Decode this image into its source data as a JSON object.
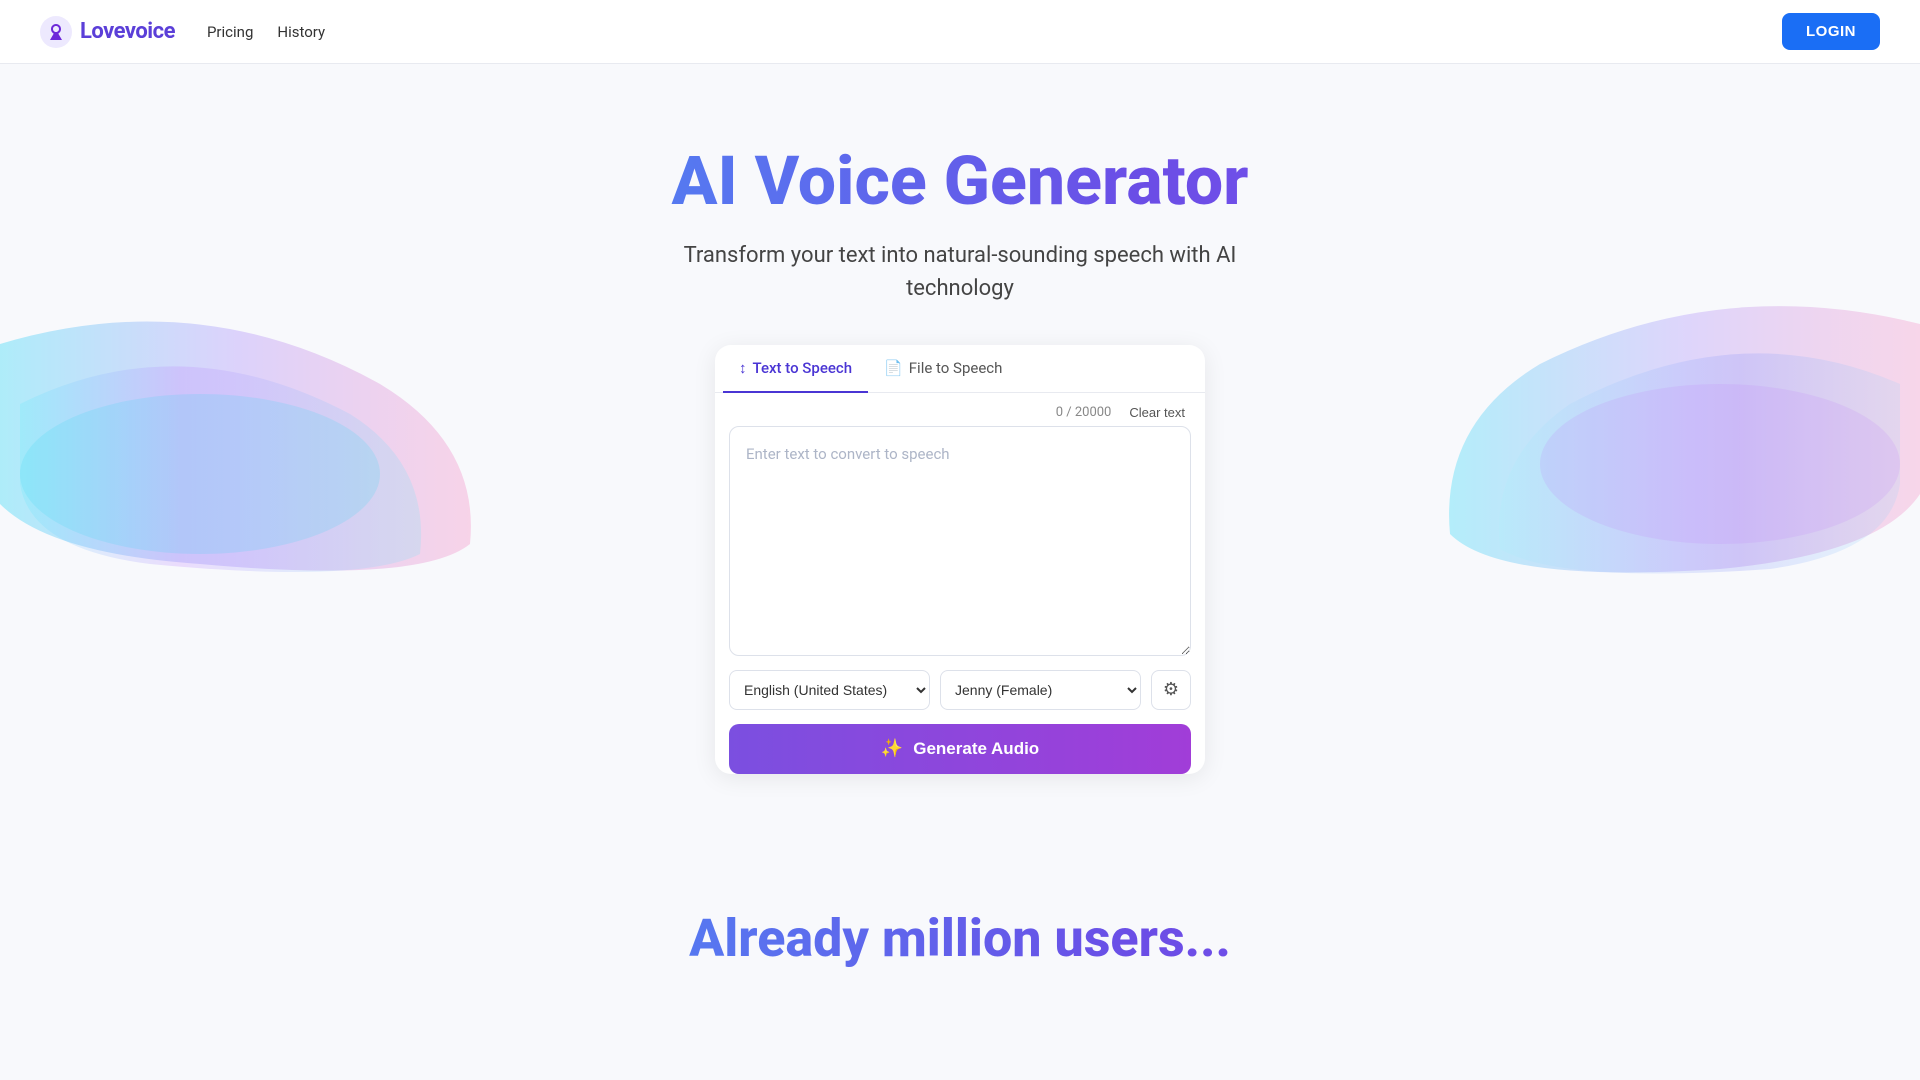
{
  "brand": {
    "name": "Lovevoice",
    "logo_alt": "Lovevoice logo"
  },
  "nav": {
    "pricing_label": "Pricing",
    "history_label": "History",
    "login_label": "LOGIN"
  },
  "hero": {
    "title": "AI Voice Generator",
    "subtitle": "Transform your text into natural-sounding speech with AI technology"
  },
  "tabs": [
    {
      "id": "text-to-speech",
      "label": "Text to Speech",
      "icon": "↕",
      "active": true
    },
    {
      "id": "file-to-speech",
      "label": "File to Speech",
      "icon": "📄",
      "active": false
    }
  ],
  "textarea": {
    "placeholder": "Enter text to convert to speech",
    "char_count": "0",
    "char_max": "20000",
    "clear_label": "Clear text"
  },
  "controls": {
    "language_default": "English (United States)",
    "voice_default": "Jenny (Female)",
    "settings_icon": "⚙"
  },
  "generate_button": {
    "label": "Generate Audio",
    "icon": "✨"
  },
  "bottom": {
    "title": "Already million users..."
  },
  "colors": {
    "brand_purple": "#5b3fd8",
    "brand_blue": "#1a6ef5",
    "gradient_start": "#38b6ff",
    "gradient_end": "#8b5cf6",
    "generate_start": "#7b4fe0",
    "generate_end": "#a13dd8"
  }
}
